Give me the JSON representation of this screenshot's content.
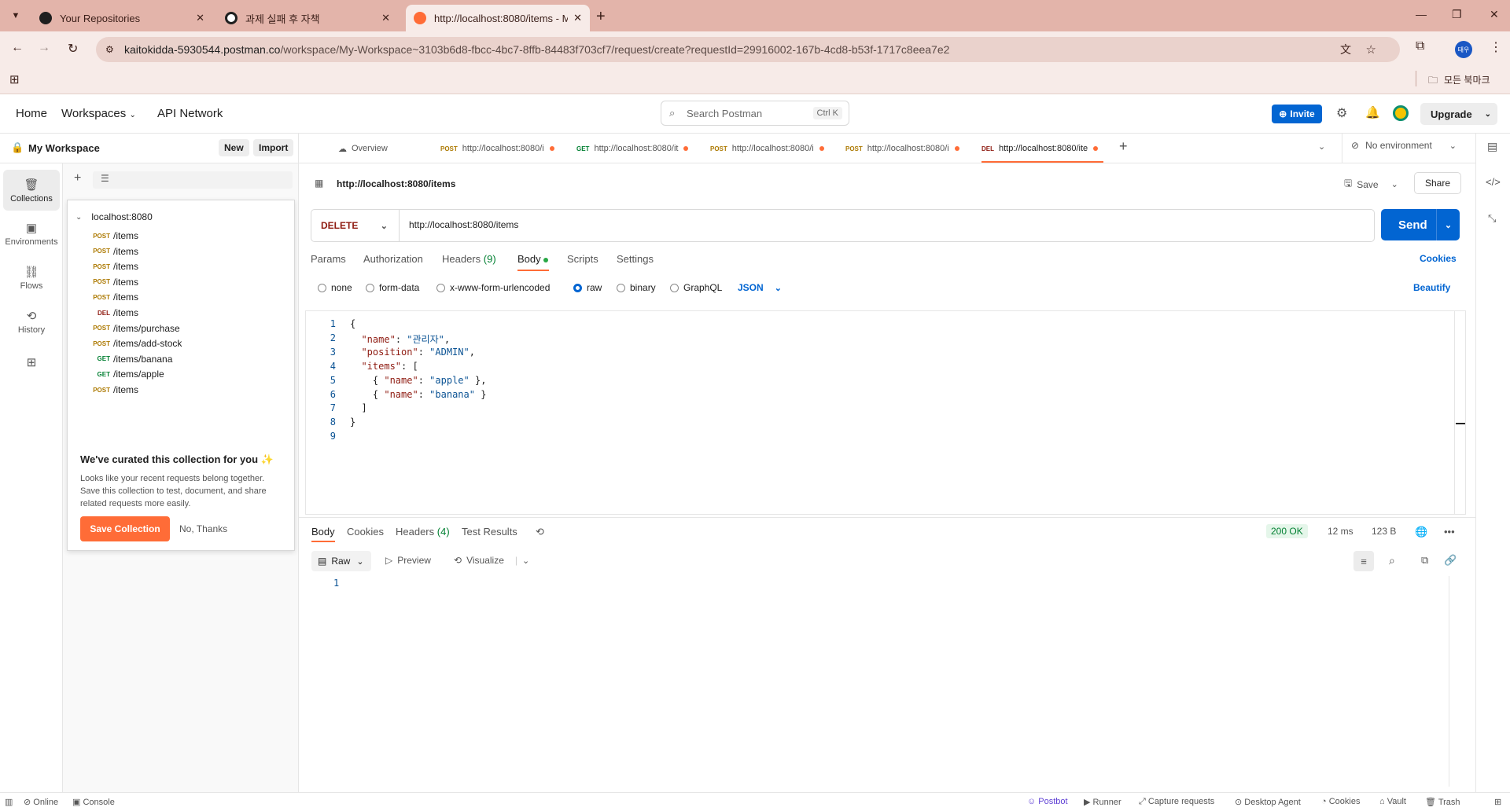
{
  "browser": {
    "tabs": [
      {
        "title": "Your Repositories"
      },
      {
        "title": "과제 실패 후 자책"
      },
      {
        "title": "http://localhost:8080/items - M"
      }
    ],
    "url_domain": "kaitokidda-5930544.postman.co",
    "url_path": "/workspace/My-Workspace~3103b6d8-fbcc-4bc7-8ffb-84483f703cf7/request/create?requestId=29916002-167b-4cd8-b53f-1717c8eea7e2",
    "profile_label": "태우",
    "bookmarks_label": "모든 북마크"
  },
  "header": {
    "home": "Home",
    "workspaces": "Workspaces",
    "api_network": "API Network",
    "search_placeholder": "Search Postman",
    "search_shortcut": "Ctrl K",
    "invite": "Invite",
    "upgrade": "Upgrade"
  },
  "workspace": {
    "name": "My Workspace",
    "new": "New",
    "import": "Import"
  },
  "rail": {
    "items": [
      "Collections",
      "Environments",
      "Flows",
      "History"
    ]
  },
  "collection": {
    "name": "localhost:8080",
    "requests": [
      {
        "method": "POST",
        "path": "/items"
      },
      {
        "method": "POST",
        "path": "/items"
      },
      {
        "method": "POST",
        "path": "/items"
      },
      {
        "method": "POST",
        "path": "/items"
      },
      {
        "method": "POST",
        "path": "/items"
      },
      {
        "method": "DEL",
        "path": "/items"
      },
      {
        "method": "POST",
        "path": "/items/purchase"
      },
      {
        "method": "POST",
        "path": "/items/add-stock"
      },
      {
        "method": "GET",
        "path": "/items/banana"
      },
      {
        "method": "GET",
        "path": "/items/apple"
      },
      {
        "method": "POST",
        "path": "/items"
      }
    ]
  },
  "curated": {
    "title": "We've curated this collection for you ✨",
    "body_1": "Looks like your recent requests belong together.",
    "body_2": "Save this collection to test, document, and share",
    "body_3": "related requests more easily.",
    "save": "Save Collection",
    "dismiss": "No, Thanks"
  },
  "request_tabs": [
    {
      "method": "",
      "label": "Overview"
    },
    {
      "method": "POST",
      "label": "http://localhost:8080/i"
    },
    {
      "method": "GET",
      "label": "http://localhost:8080/it"
    },
    {
      "method": "POST",
      "label": "http://localhost:8080/i"
    },
    {
      "method": "POST",
      "label": "http://localhost:8080/i"
    },
    {
      "method": "DEL",
      "label": "http://localhost:8080/ite"
    }
  ],
  "environment": "No environment",
  "request": {
    "title": "http://localhost:8080/items",
    "save": "Save",
    "share": "Share",
    "method": "DELETE",
    "url": "http://localhost:8080/items",
    "send": "Send",
    "tabs": {
      "params": "Params",
      "authorization": "Authorization",
      "headers": "Headers",
      "headers_count": "(9)",
      "body": "Body",
      "scripts": "Scripts",
      "settings": "Settings",
      "cookies": "Cookies"
    },
    "body_types": [
      "none",
      "form-data",
      "x-www-form-urlencoded",
      "raw",
      "binary",
      "GraphQL"
    ],
    "selected_body_type": "raw",
    "format": "JSON",
    "beautify": "Beautify",
    "code_lines": [
      {
        "n": "1",
        "t": "{"
      },
      {
        "n": "2",
        "t": "  \"name\": \"관리자\","
      },
      {
        "n": "3",
        "t": "  \"position\": \"ADMIN\","
      },
      {
        "n": "4",
        "t": "  \"items\": ["
      },
      {
        "n": "5",
        "t": "    { \"name\": \"apple\" },"
      },
      {
        "n": "6",
        "t": "    { \"name\": \"banana\" }"
      },
      {
        "n": "7",
        "t": "  ]"
      },
      {
        "n": "8",
        "t": "}"
      },
      {
        "n": "9",
        "t": ""
      }
    ]
  },
  "response": {
    "tabs": {
      "body": "Body",
      "cookies": "Cookies",
      "headers": "Headers",
      "headers_count": "(4)",
      "test_results": "Test Results"
    },
    "status": "200 OK",
    "time": "12 ms",
    "size": "123 B",
    "view_raw": "Raw",
    "view_preview": "Preview",
    "view_visualize": "Visualize",
    "line_1": "1"
  },
  "footer": {
    "online": "Online",
    "console": "Console",
    "postbot": "Postbot",
    "runner": "Runner",
    "capture": "Capture requests",
    "agent": "Desktop Agent",
    "cookies": "Cookies",
    "vault": "Vault",
    "trash": "Trash"
  },
  "colors": {
    "chrome_frame": "#e3b4aa",
    "accent_orange": "#ff6c37",
    "send_blue": "#0265d2",
    "post": "#ad7a03",
    "get": "#007f31",
    "delete": "#8e1a10"
  }
}
